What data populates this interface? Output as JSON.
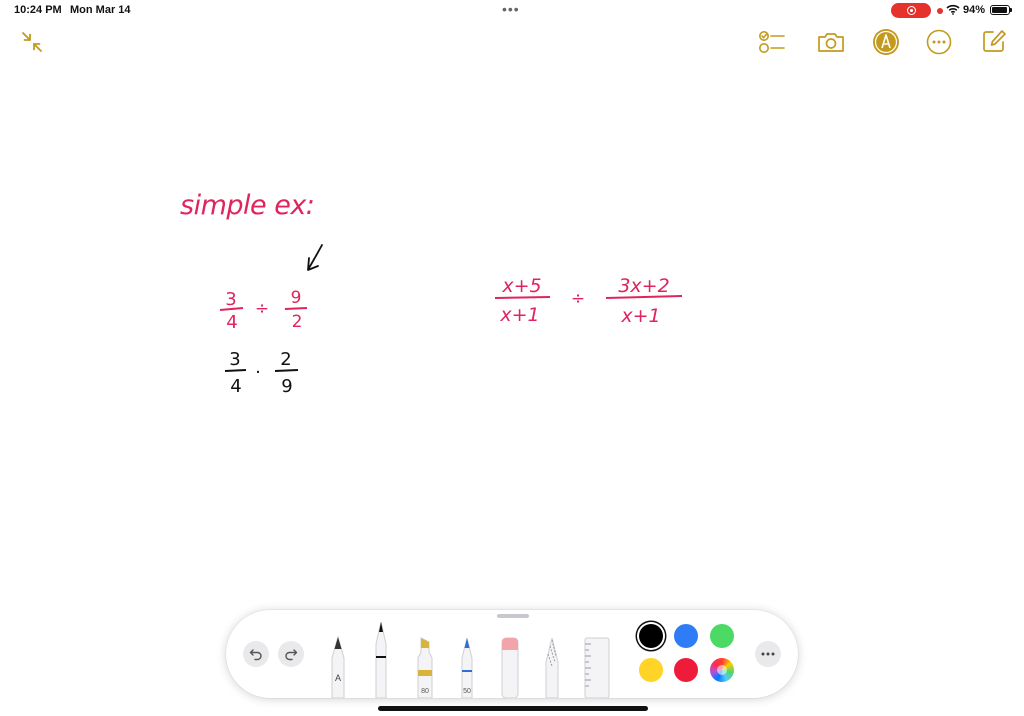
{
  "status_bar": {
    "time": "10:24 PM",
    "date": "Mon Mar 14",
    "battery": "94%",
    "battery_level": 0.94
  },
  "toolbar": {
    "icons": [
      "collapse-icon",
      "checklist-icon",
      "camera-icon",
      "markup-icon",
      "more-icon",
      "compose-icon"
    ],
    "accent_color": "#c49a1e"
  },
  "note": {
    "heading": "simple ex:",
    "example_left": {
      "dividend": {
        "numerator": "3",
        "denominator": "4"
      },
      "operator": "÷",
      "divisor": {
        "numerator": "9",
        "denominator": "2"
      },
      "rewritten": {
        "first": {
          "numerator": "3",
          "denominator": "4"
        },
        "operator": "·",
        "reciprocal": {
          "numerator": "2",
          "denominator": "9"
        }
      }
    },
    "example_right": {
      "dividend": {
        "numerator": "x+5",
        "denominator": "x+1"
      },
      "operator": "÷",
      "divisor": {
        "numerator": "3x+2",
        "denominator": "x+1"
      }
    },
    "ink_red": "#e0245e",
    "ink_black": "#111111"
  },
  "palette": {
    "tools": [
      {
        "name": "pen",
        "label": "A"
      },
      {
        "name": "marker",
        "label": ""
      },
      {
        "name": "highlighter",
        "label": "80"
      },
      {
        "name": "pencil-blue",
        "label": "50"
      },
      {
        "name": "eraser",
        "label": ""
      },
      {
        "name": "lasso",
        "label": ""
      },
      {
        "name": "ruler",
        "label": ""
      }
    ],
    "colors": [
      "#000000",
      "#2f7df6",
      "#4cd964",
      "#ffd426",
      "#ee1c3a"
    ],
    "selected_color": "#000000"
  }
}
